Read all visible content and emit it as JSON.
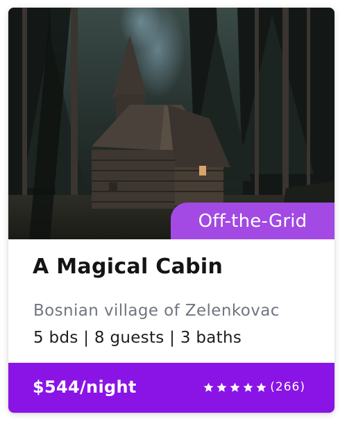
{
  "listing": {
    "badge": "Off-the-Grid",
    "title": "A Magical Cabin",
    "location": "Bosnian village of Zelenkovac",
    "details": "5 bds | 8 guests | 3 baths",
    "price": "$544/night",
    "rating_stars": 5,
    "review_count": "(266)"
  },
  "colors": {
    "footer": "#8a14e6",
    "badge": "#a24ae3"
  },
  "icons": {
    "star": "star-icon"
  }
}
